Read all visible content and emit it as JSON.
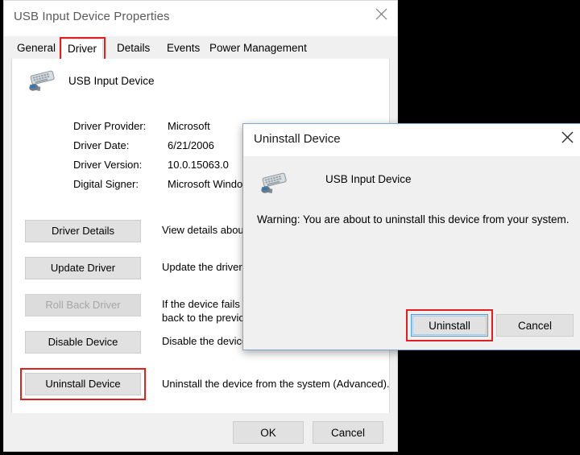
{
  "properties_window": {
    "title": "USB Input Device Properties",
    "close_icon": "close-icon",
    "tabs": [
      {
        "label": "General",
        "selected": false
      },
      {
        "label": "Driver",
        "selected": true
      },
      {
        "label": "Details",
        "selected": false
      },
      {
        "label": "Events",
        "selected": false
      },
      {
        "label": "Power Management",
        "selected": false
      }
    ],
    "highlighted_tab": "Driver",
    "device": {
      "icon": "usb-input-device-icon",
      "name": "USB Input Device"
    },
    "driver_info": [
      {
        "label": "Driver Provider:",
        "value": "Microsoft"
      },
      {
        "label": "Driver Date:",
        "value": "6/21/2006"
      },
      {
        "label": "Driver Version:",
        "value": "10.0.15063.0"
      },
      {
        "label": "Digital Signer:",
        "value": "Microsoft Windows"
      }
    ],
    "actions": [
      {
        "button": "Driver Details",
        "description": "View details about the installed driver files.",
        "disabled": false,
        "highlighted": false
      },
      {
        "button": "Update Driver",
        "description": "Update the driver for this device.",
        "disabled": false,
        "highlighted": false
      },
      {
        "button": "Roll Back Driver",
        "description": "If the device fails after updating the driver, roll back to the previously installed driver.",
        "disabled": true,
        "highlighted": false
      },
      {
        "button": "Disable Device",
        "description": "Disable the device.",
        "disabled": false,
        "highlighted": false
      },
      {
        "button": "Uninstall Device",
        "description": "Uninstall the device from the system (Advanced).",
        "disabled": false,
        "highlighted": true
      }
    ],
    "footer": {
      "ok_label": "OK",
      "cancel_label": "Cancel"
    }
  },
  "uninstall_dialog": {
    "title": "Uninstall Device",
    "close_icon": "close-icon",
    "device": {
      "icon": "usb-input-device-icon",
      "name": "USB Input Device"
    },
    "warning": "Warning: You are about to uninstall this device from your system.",
    "confirm_label": "Uninstall",
    "cancel_label": "Cancel",
    "highlighted_button": "Uninstall"
  },
  "colors": {
    "highlight_red": "#e02020",
    "dialog_border_blue": "#7fa9cd",
    "focus_blue": "#5b9bd5",
    "window_chrome": "#f0f0f0",
    "page_background": "#000000"
  }
}
